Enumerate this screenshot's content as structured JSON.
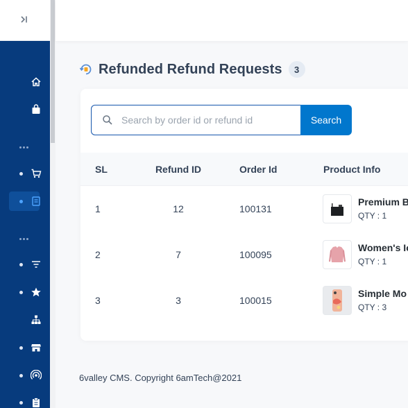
{
  "page": {
    "title": "Refunded Refund Requests",
    "count": "3"
  },
  "search": {
    "placeholder": "Search by order id or refund id",
    "value": "",
    "button_label": "Search"
  },
  "table": {
    "headers": [
      "SL",
      "Refund ID",
      "Order Id",
      "Product Info"
    ],
    "rows": [
      {
        "sl": "1",
        "refund_id": "12",
        "order_id": "100131",
        "product_name": "Premium B",
        "qty": "QTY : 1",
        "thumb_icon": "black-device-icon"
      },
      {
        "sl": "2",
        "refund_id": "7",
        "order_id": "100095",
        "product_name": "Women's Ic",
        "qty": "QTY : 1",
        "thumb_icon": "pink-sweater-icon"
      },
      {
        "sl": "3",
        "refund_id": "3",
        "order_id": "100015",
        "product_name": "Simple Mo",
        "qty": "QTY : 3",
        "thumb_icon": "phone-case-icon"
      }
    ]
  },
  "footer": {
    "text": "6valley CMS. Copyright 6amTech@2021"
  },
  "sidebar": {
    "toggle_icon": "collapse-toggle-icon",
    "items": [
      {
        "icon": "home-icon",
        "has_dot": false,
        "active": false
      },
      {
        "icon": "shopping-bag-icon",
        "has_dot": false,
        "active": false
      },
      {
        "icon": "cart-icon",
        "has_dot": true,
        "active": false
      },
      {
        "icon": "refund-receipt-icon",
        "has_dot": true,
        "active": true
      },
      {
        "icon": "filter-icon",
        "has_dot": true,
        "active": false
      },
      {
        "icon": "star-icon",
        "has_dot": true,
        "active": false
      },
      {
        "icon": "sitemap-icon",
        "has_dot": false,
        "active": false
      },
      {
        "icon": "store-icon",
        "has_dot": true,
        "active": false
      },
      {
        "icon": "broadcast-icon",
        "has_dot": true,
        "active": false
      },
      {
        "icon": "clipboard-icon",
        "has_dot": true,
        "active": false
      }
    ]
  },
  "colors": {
    "sidebar_bg": "#073b7d",
    "primary": "#0177cd",
    "text": "#334257"
  }
}
